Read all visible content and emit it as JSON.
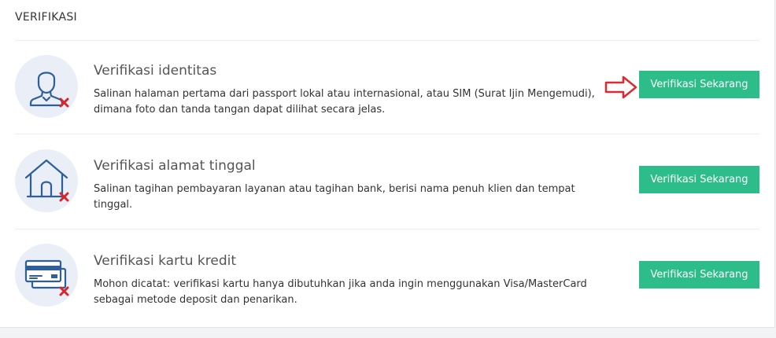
{
  "section": {
    "title": "VERIFIKASI"
  },
  "items": [
    {
      "title": "Verifikasi identitas",
      "description": "Salinan halaman pertama dari passport lokal atau internasional, atau SIM (Surat Ijin Mengemudi), dimana foto dan tanda tangan dapat dilihat secara jelas.",
      "button": "Verifikasi Sekarang",
      "icon": "user-icon",
      "status_icon": "red-x-icon"
    },
    {
      "title": "Verifikasi alamat tinggal",
      "description": "Salinan tagihan pembayaran layanan atau tagihan bank, berisi nama penuh klien dan tempat tinggal.",
      "button": "Verifikasi Sekarang",
      "icon": "house-icon",
      "status_icon": "red-x-icon"
    },
    {
      "title": "Verifikasi kartu kredit",
      "description": "Mohon dicatat: verifikasi kartu hanya dibutuhkan jika anda ingin menggunakan Visa/MasterCard sebagai metode deposit dan penarikan.",
      "button": "Verifikasi Sekarang",
      "icon": "credit-card-icon",
      "status_icon": "red-x-icon"
    }
  ],
  "colors": {
    "accent_button": "#2dbd8a",
    "icon_blue": "#2f5f98",
    "icon_bg": "#e9eef7",
    "status_red": "#d9262b",
    "annotation_arrow": "#e0282e"
  }
}
